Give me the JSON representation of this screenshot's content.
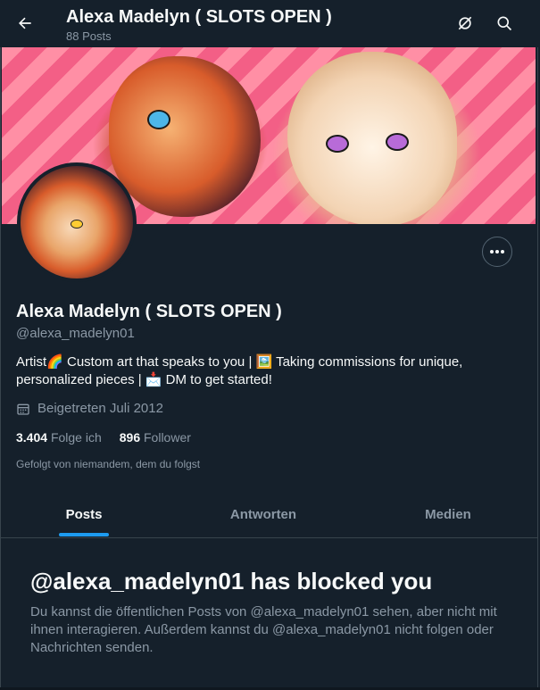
{
  "header": {
    "title": "Alexa Madelyn ( SLOTS OPEN )",
    "posts_count": "88 Posts"
  },
  "profile": {
    "name": "Alexa Madelyn ( SLOTS OPEN )",
    "handle": "@alexa_madelyn01",
    "bio": "Artist🌈 Custom art that speaks to you | 🖼️ Taking commissions for unique, personalized pieces | 📩 DM to get started!",
    "joined": "Beigetreten Juli 2012",
    "following_count": "3.404",
    "following_label": "Folge ich",
    "followers_count": "896",
    "followers_label": "Follower",
    "followed_by": "Gefolgt von niemandem, dem du folgst"
  },
  "tabs": [
    {
      "label": "Posts"
    },
    {
      "label": "Antworten"
    },
    {
      "label": "Medien"
    }
  ],
  "blocked": {
    "title": "@alexa_madelyn01 has blocked you",
    "text": "Du kannst die öffentlichen Posts von @alexa_madelyn01 sehen, aber nicht mit ihnen interagieren. Außerdem kannst du @alexa_madelyn01 nicht folgen oder Nachrichten senden."
  },
  "colors": {
    "background": "#15202b",
    "accent": "#1d9bf0",
    "secondary_text": "#8b98a5"
  }
}
